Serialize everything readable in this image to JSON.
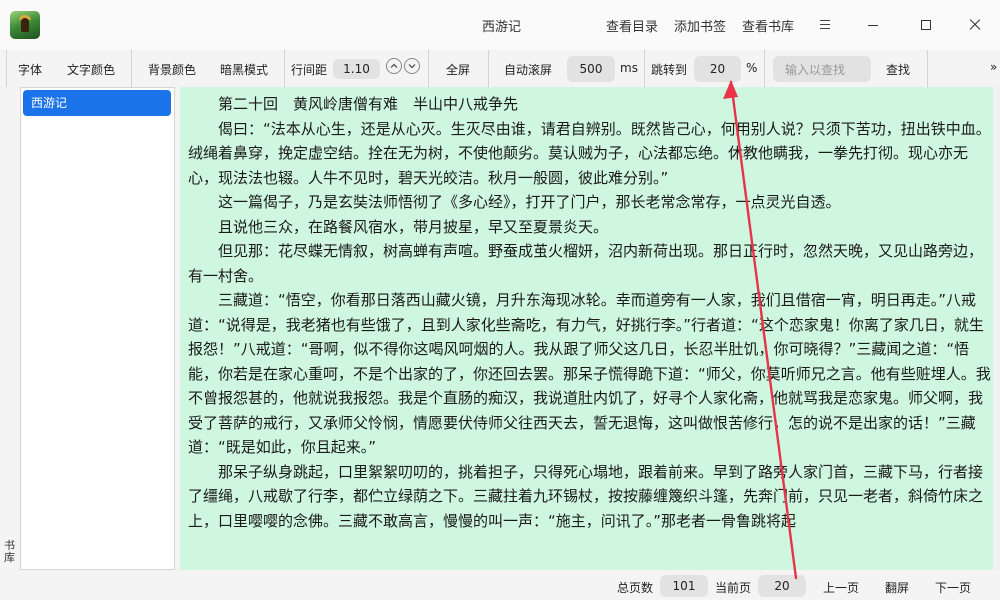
{
  "window": {
    "title": "西游记",
    "links": [
      "查看目录",
      "添加书签",
      "查看书库"
    ],
    "icons": {
      "app": "app-icon",
      "menu": "menu-icon",
      "minimize": "minimize-icon",
      "maximize": "maximize-icon",
      "close": "close-icon"
    }
  },
  "toolbar": {
    "font": "字体",
    "text_color": "文字颜色",
    "bg_color": "背景颜色",
    "dark_mode": "暗黑模式",
    "line_spacing_label": "行间距",
    "line_spacing_value": "1.10",
    "fullscreen": "全屏",
    "auto_scroll": "自动滚屏",
    "scroll_speed": "500",
    "scroll_unit": "ms",
    "jump_label": "跳转到",
    "jump_value": "20",
    "jump_unit": "%",
    "search_placeholder": "输入以查找",
    "search_button": "查找",
    "overflow": "»"
  },
  "sidebar": {
    "tab_label": "书库",
    "books": [
      {
        "title": "西游记",
        "selected": true
      }
    ]
  },
  "reader": {
    "background": "#cff7e0",
    "paragraphs": [
      "第二十回　黄风岭唐僧有难　半山中八戒争先",
      "偈曰：“法本从心生，还是从心灭。生灭尽由谁，请君自辨别。既然皆己心，何用别人说？只须下苦功，扭出铁中血。绒绳着鼻穿，挽定虚空结。拴在无为树，不使他颠劣。莫认贼为子，心法都忘绝。休教他瞒我，一拳先打彻。现心亦无心，现法法也辍。人牛不见时，碧天光皎洁。秋月一般圆，彼此难分别。”",
      "这一篇偈子，乃是玄奘法师悟彻了《多心经》，打开了门户，那长老常念常存，一点灵光自透。",
      "且说他三众，在路餐风宿水，带月披星，早又至夏景炎天。",
      "但见那：花尽蝶无情叙，树高蝉有声喧。野蚕成茧火榴妍，沼内新荷出现。那日正行时，忽然天晚，又见山路旁边，有一村舍。",
      "三藏道：“悟空，你看那日落西山藏火镜，月升东海现冰轮。幸而道旁有一人家，我们且借宿一宵，明日再走。”八戒道：“说得是，我老猪也有些饿了，且到人家化些斋吃，有力气，好挑行李。”行者道：“这个恋家鬼！你离了家几日，就生报怨！”八戒道：“哥啊，似不得你这喝风呵烟的人。我从跟了师父这几日，长忍半肚饥，你可晓得？”三藏闻之道：“悟能，你若是在家心重呵，不是个出家的了，你还回去罢。那呆子慌得跪下道：“师父，你莫听师兄之言。他有些赃埋人。我不曾报怨甚的，他就说我报怨。我是个直肠的痴汉，我说道肚内饥了，好寻个人家化斋，他就骂我是恋家鬼。师父啊，我受了菩萨的戒行，又承师父怜悯，情愿要伏侍师父往西天去，誓无退悔，这叫做恨苦修行，怎的说不是出家的话！”三藏道：“既是如此，你且起来。”",
      "那呆子纵身跳起，口里絮絮叨叨的，挑着担子，只得死心塌地，跟着前来。早到了路旁人家门首，三藏下马，行者接了缰绳，八戒歇了行李，都伫立绿荫之下。三藏拄着九环锡杖，按按藤缠篾织斗篷，先奔门前，只见一老者，斜倚竹床之上，口里嘤嘤的念佛。三藏不敢高言，慢慢的叫一声：“施主，问讯了。”那老者一骨鲁跳将起"
    ]
  },
  "bottom": {
    "total_label": "总页数",
    "total_value": "101",
    "current_label": "当前页",
    "current_value": "20",
    "prev": "上一页",
    "flip": "翻屏",
    "next": "下一页"
  },
  "annotation": {
    "color": "#e8334a"
  }
}
